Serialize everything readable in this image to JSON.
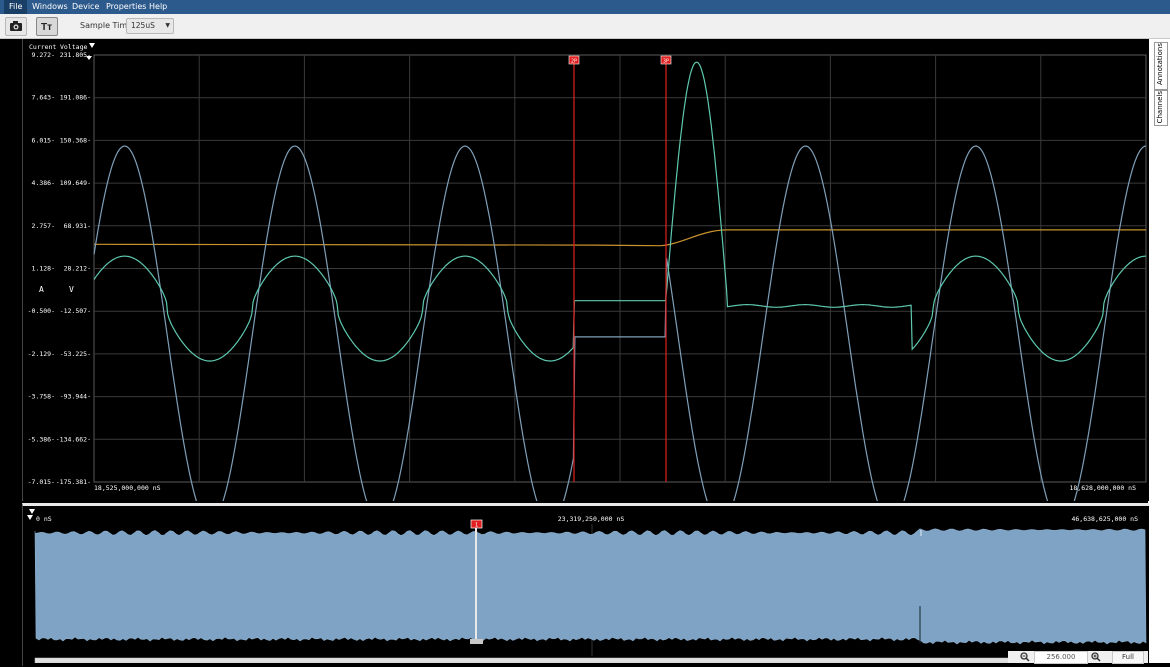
{
  "menu": [
    "File",
    "Windows",
    "Device",
    "Properties",
    "Help"
  ],
  "toolbar": {
    "sample_label": "Sample Time:",
    "sample_value": "125uS"
  },
  "side_tabs": {
    "annotations": "Annotations",
    "channels": "Channels"
  },
  "axes": {
    "current_header": "Current",
    "voltage_header": "Voltage",
    "current_unit": "A",
    "voltage_unit": "V",
    "current_ticks": [
      "9.272",
      "7.643",
      "6.015",
      "4.386",
      "2.757",
      "1.128",
      "-0.500",
      "-2.129",
      "-3.758",
      "-5.386",
      "-7.015"
    ],
    "voltage_ticks": [
      "231.805",
      "191.086",
      "150.368",
      "109.649",
      "68.931",
      "28.212",
      "-12.507",
      "-53.225",
      "-93.944",
      "-134.662",
      "-175.381"
    ],
    "x_start": "18,525,000,000 nS",
    "x_end": "18,628,000,000 nS"
  },
  "markers": [
    {
      "label": "2P",
      "position_ns": 18572000000
    },
    {
      "label": "3P",
      "position_ns": 18581000000
    }
  ],
  "overview": {
    "start": "0 nS",
    "mid": "23,319,250,000 nS",
    "end": "46,638,625,000 nS",
    "marker_label": "1"
  },
  "zoom": {
    "value": "256.000",
    "full_label": "Full"
  },
  "colors": {
    "menubar": "#2d5a8c",
    "voltage_trace": "#7f9fb8",
    "current_trace": "#5ec8b0",
    "aux_trace": "#c8922e",
    "marker": "#e02020",
    "overview_fill": "#7fa3c5"
  }
}
